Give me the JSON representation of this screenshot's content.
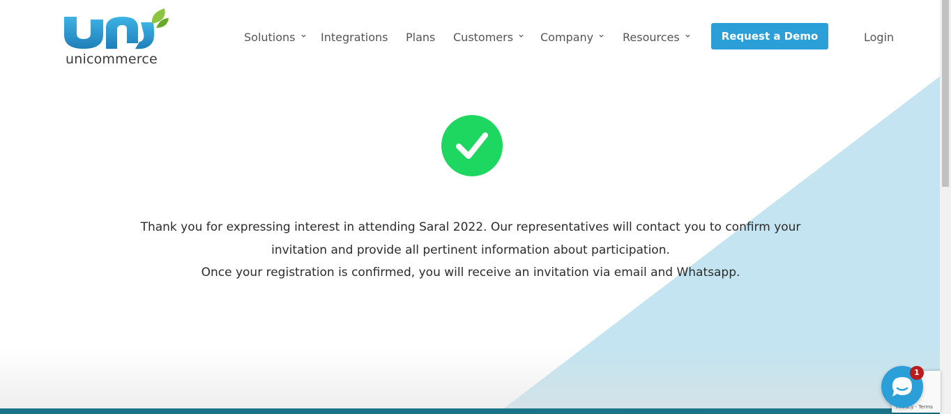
{
  "logo": {
    "text": "unicommerce",
    "icon": "unicommerce-logo-icon"
  },
  "nav": {
    "items": [
      {
        "label": "Solutions",
        "dropdown": true
      },
      {
        "label": "Integrations",
        "dropdown": false
      },
      {
        "label": "Plans",
        "dropdown": false
      },
      {
        "label": "Customers",
        "dropdown": true
      },
      {
        "label": "Company",
        "dropdown": true
      },
      {
        "label": "Resources",
        "dropdown": true
      }
    ],
    "demo_button": "Request a Demo",
    "login": "Login"
  },
  "content": {
    "icon": "check-circle-icon",
    "line1": "Thank you for expressing interest in attending Saral 2022. Our representatives will contact you to confirm your",
    "line2": "invitation and provide all pertinent information about participation.",
    "line3": "Once your registration is confirmed, you will receive an invitation via email and Whatsapp."
  },
  "chat": {
    "icon": "chat-icon",
    "badge": "1"
  },
  "recaptcha": {
    "text": "Privacy - Terms"
  },
  "colors": {
    "accent": "#2a9fd8",
    "success": "#1ed760",
    "triangle": "#c3e4f0",
    "bottom_bar": "#1b7388",
    "badge": "#b81c1c"
  }
}
